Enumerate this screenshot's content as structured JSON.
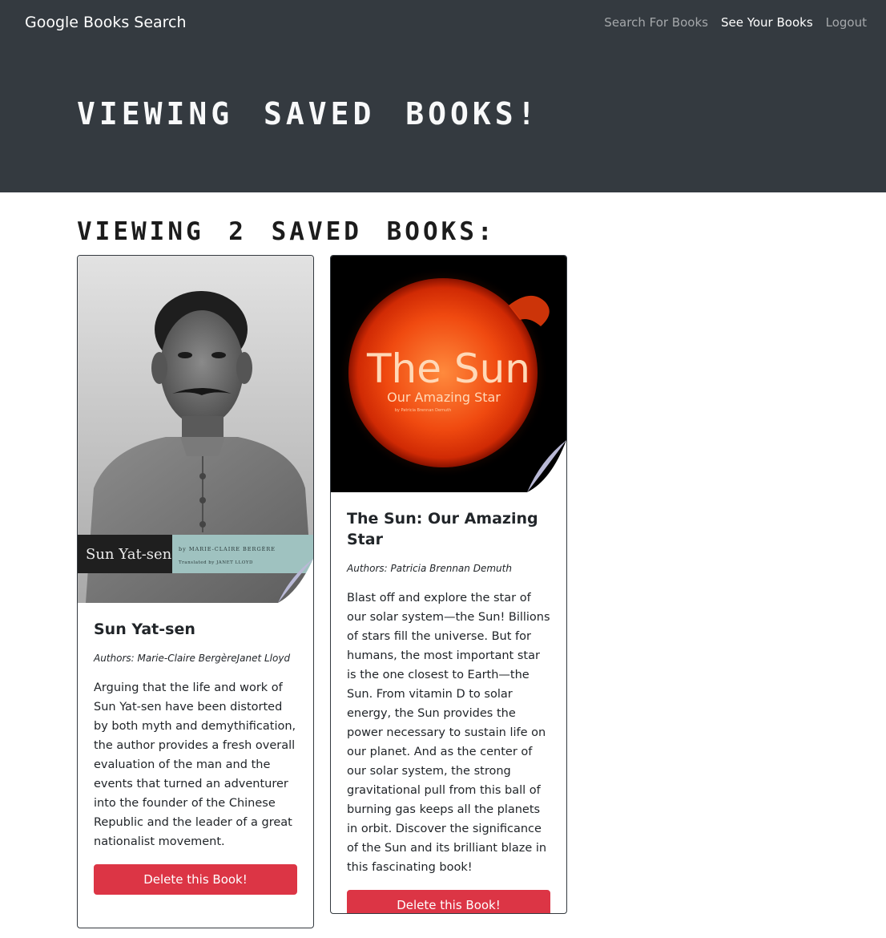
{
  "navbar": {
    "brand": "Google Books Search",
    "links": [
      {
        "label": "Search For Books",
        "active": false
      },
      {
        "label": "See Your Books",
        "active": true
      },
      {
        "label": "Logout",
        "active": false
      }
    ]
  },
  "jumbotron": {
    "title": "Viewing saved books!"
  },
  "saved": {
    "heading": "Viewing 2 saved books:"
  },
  "books": [
    {
      "title": "Sun Yat-sen",
      "authors": "Authors: Marie-Claire BergèreJanet Lloyd",
      "description": "Arguing that the life and work of Sun Yat-sen have been distorted by both myth and demythification, the author provides a fresh overall evaluation of the man and the events that turned an adventurer into the founder of the Chinese Republic and the leader of a great nationalist movement.",
      "delete_label": "Delete this Book!",
      "cover": {
        "title": "Sun Yat-sen",
        "author_line": "by MARIE-CLAIRE BERGÈRE",
        "translator_line": "Translated by JANET LLOYD"
      }
    },
    {
      "title": "The Sun: Our Amazing Star",
      "authors": "Authors: Patricia Brennan Demuth",
      "description": "Blast off and explore the star of our solar system—the Sun! Billions of stars fill the universe. But for humans, the most important star is the one closest to Earth—the Sun. From vitamin D to solar energy, the Sun provides the power necessary to sustain life on our planet. And as the center of our solar system, the strong gravitational pull from this ball of burning gas keeps all the planets in orbit. Discover the significance of the Sun and its brilliant blaze in this fascinating book!",
      "delete_label": "Delete this Book!",
      "cover": {
        "title": "The Sun",
        "subtitle": "Our Amazing Star",
        "author_line": "by Patricia Brennan Demuth"
      }
    }
  ],
  "colors": {
    "navbar_bg": "#343a40",
    "delete_button": "#dc3545",
    "card_border": "#343a40"
  }
}
